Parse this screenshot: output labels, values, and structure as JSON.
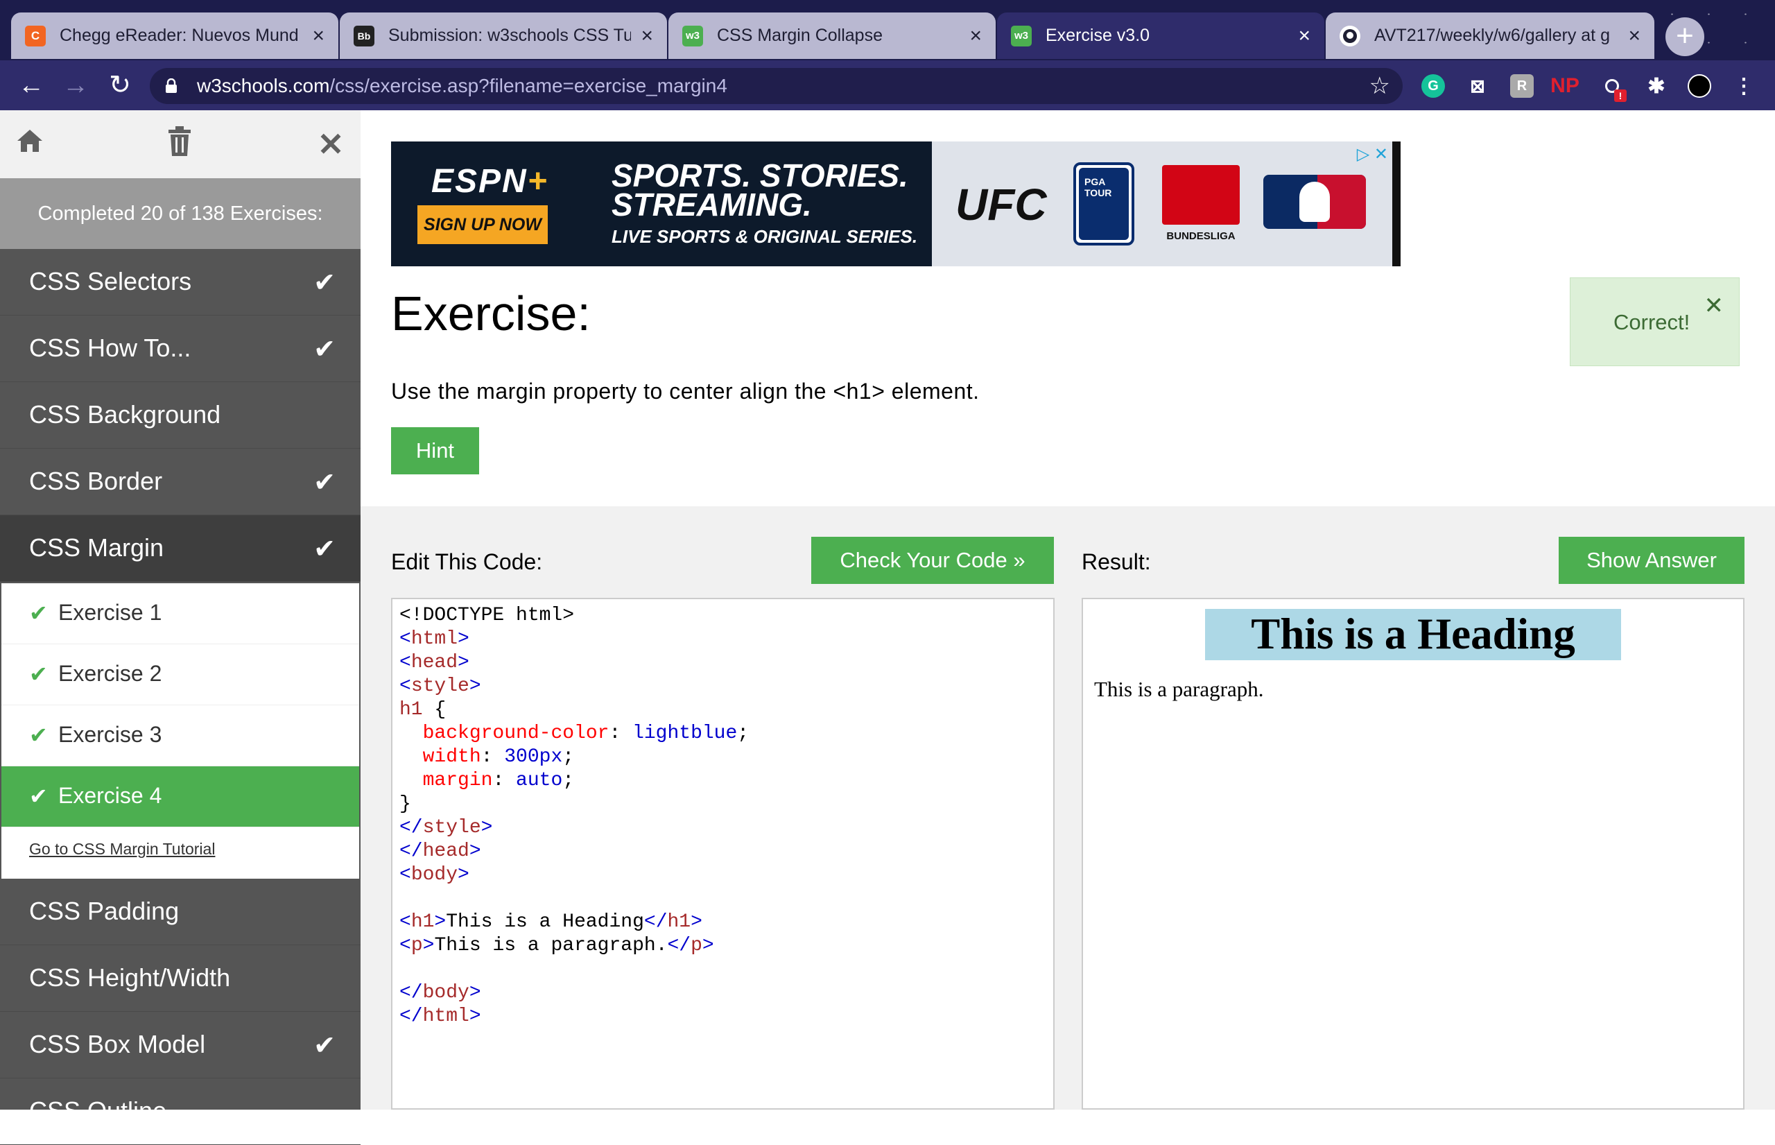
{
  "browser": {
    "tabs": [
      {
        "title": "Chegg eReader: Nuevos Mund",
        "favicon": "C"
      },
      {
        "title": "Submission: w3schools CSS Tu",
        "favicon": "Bb"
      },
      {
        "title": "CSS Margin Collapse",
        "favicon": "w3"
      },
      {
        "title": "Exercise v3.0",
        "favicon": "w3"
      },
      {
        "title": "AVT217/weekly/w6/gallery at g",
        "favicon": "github"
      }
    ],
    "active_tab": 3,
    "url_host": "w3schools.com",
    "url_path": "/css/exercise.asp?filename=exercise_margin4",
    "extensions": [
      "G",
      "⊠",
      "R",
      "NP",
      "!"
    ]
  },
  "sidebar": {
    "completed_text": "Completed 20 of 138 Exercises:",
    "categories_top": [
      {
        "label": "CSS Selectors",
        "done": true
      },
      {
        "label": "CSS How To...",
        "done": true
      },
      {
        "label": "CSS Background",
        "done": false
      },
      {
        "label": "CSS Border",
        "done": true
      },
      {
        "label": "CSS Margin",
        "done": true
      }
    ],
    "exercises": [
      {
        "label": "Exercise 1",
        "done": true
      },
      {
        "label": "Exercise 2",
        "done": true
      },
      {
        "label": "Exercise 3",
        "done": true
      },
      {
        "label": "Exercise 4",
        "done": true
      }
    ],
    "active_exercise": 3,
    "tutorial_link": "Go to CSS Margin Tutorial",
    "categories_bottom": [
      {
        "label": "CSS Padding",
        "done": false
      },
      {
        "label": "CSS Height/Width",
        "done": false
      },
      {
        "label": "CSS Box Model",
        "done": true
      },
      {
        "label": "CSS Outline",
        "done": false
      }
    ]
  },
  "ad": {
    "brand": "ESPN",
    "brand_plus": "+",
    "cta": "SIGN UP NOW",
    "headline": "SPORTS. STORIES. STREAMING.",
    "subline": "LIVE SPORTS & ORIGINAL SERIES.",
    "ufc": "UFC",
    "pga": "PGA TOUR",
    "bundesliga": "BUNDESLIGA"
  },
  "exercise": {
    "title": "Exercise:",
    "instruction": "Use the margin property to center align the <h1> element.",
    "hint_label": "Hint",
    "status": "Correct!"
  },
  "editor": {
    "label": "Edit This Code:",
    "check_label": "Check Your Code »",
    "lines": {
      "doctype": "<!DOCTYPE html>",
      "html_open": "html",
      "head_open": "head",
      "style_open": "style",
      "selector": "h1",
      "brace_open": " {",
      "p1_name": "background-color",
      "p1_value": "lightblue",
      "p2_name": "width",
      "p2_value": "300px",
      "p3_name": "margin",
      "p3_value": "auto",
      "brace_close": "}",
      "style_close": "style",
      "head_close": "head",
      "body_open": "body",
      "h1_tag": "h1",
      "h1_text": "This is a Heading",
      "p_tag": "p",
      "p_text": "This is a paragraph.",
      "body_close": "body",
      "html_close": "html"
    }
  },
  "result": {
    "label": "Result:",
    "answer_label": "Show Answer",
    "heading": "This is a Heading",
    "paragraph": "This is a paragraph."
  },
  "colors": {
    "w3_green": "#4caf50",
    "sidebar_dark": "#555555",
    "browser_frame": "#2f2c6b",
    "correct_bg": "#ddf0d8",
    "heading_bg": "lightblue"
  },
  "icons": {
    "back": "back-arrow-icon",
    "forward": "forward-arrow-icon",
    "reload": "reload-icon",
    "home": "home-icon",
    "trash": "trash-icon",
    "close": "close-icon",
    "check": "check-icon",
    "star": "star-icon",
    "lock": "lock-icon"
  }
}
